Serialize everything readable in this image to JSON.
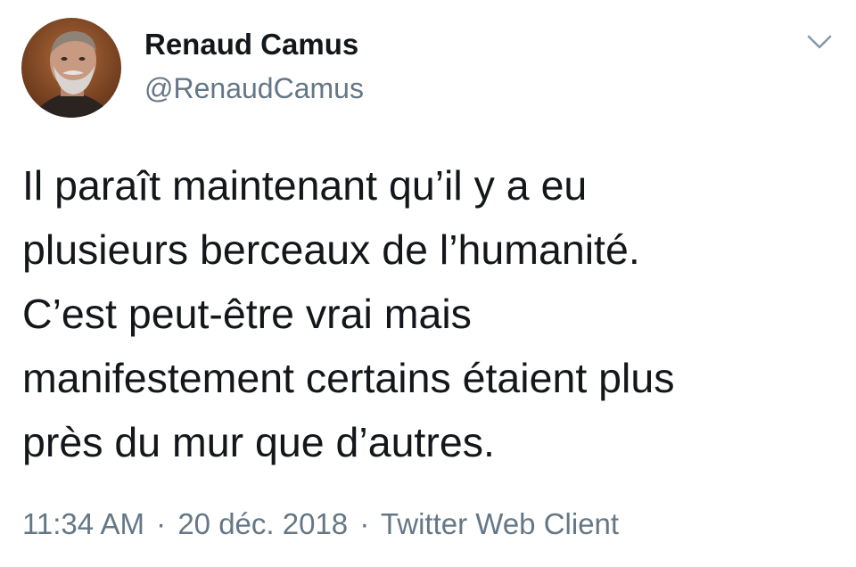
{
  "author": {
    "display_name": "Renaud Camus",
    "handle": "@RenaudCamus"
  },
  "tweet": {
    "lines": [
      "Il paraît maintenant qu’il y a eu",
      "plusieurs berceaux de l’humanité.",
      "C’est peut-être vrai mais",
      "manifestement certains étaient plus",
      "près du mur que d’autres."
    ]
  },
  "meta": {
    "time": "11:34 AM",
    "separator": "·",
    "date": "20 déc. 2018",
    "client": "Twitter Web Client"
  },
  "icons": {
    "menu": "chevron-down-icon"
  },
  "colors": {
    "text": "#14171a",
    "secondary": "#657786",
    "caret": "#8899a6"
  }
}
